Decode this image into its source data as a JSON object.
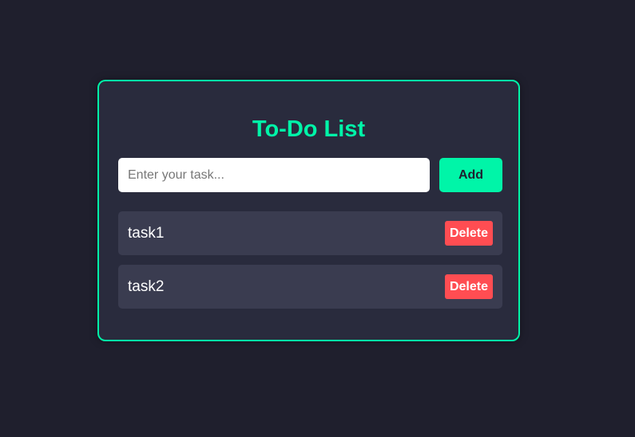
{
  "app": {
    "title": "To-Do List"
  },
  "form": {
    "input_value": "",
    "input_placeholder": "Enter your task...",
    "add_label": "Add"
  },
  "tasks": [
    {
      "text": "task1",
      "delete_label": "Delete"
    },
    {
      "text": "task2",
      "delete_label": "Delete"
    }
  ],
  "colors": {
    "background": "#1f1f2d",
    "card": "#292b3d",
    "accent": "#00f5a8",
    "task_row": "#3a3c50",
    "delete": "#ff4d52"
  }
}
